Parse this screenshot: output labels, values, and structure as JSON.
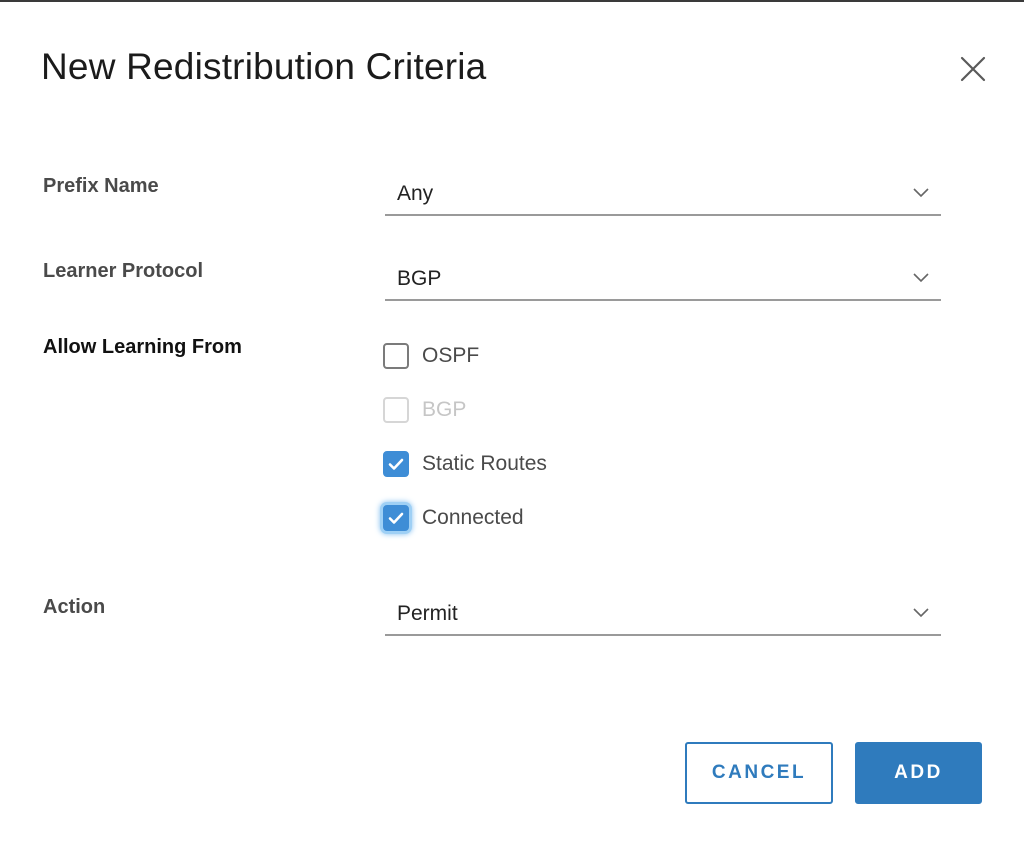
{
  "dialog": {
    "title": "New Redistribution Criteria",
    "close_icon": "close-icon"
  },
  "form": {
    "prefix_name": {
      "label": "Prefix Name",
      "value": "Any"
    },
    "learner_protocol": {
      "label": "Learner Protocol",
      "value": "BGP"
    },
    "allow_learning_from": {
      "label": "Allow Learning From",
      "options": [
        {
          "label": "OSPF",
          "checked": false,
          "disabled": false
        },
        {
          "label": "BGP",
          "checked": false,
          "disabled": true
        },
        {
          "label": "Static Routes",
          "checked": true,
          "disabled": false
        },
        {
          "label": "Connected",
          "checked": true,
          "disabled": false,
          "focused": true
        }
      ]
    },
    "action": {
      "label": "Action",
      "value": "Permit"
    }
  },
  "buttons": {
    "cancel_label": "CANCEL",
    "add_label": "ADD"
  },
  "colors": {
    "accent": "#2f7bbd",
    "checkbox_checked": "#3e8dd6"
  }
}
